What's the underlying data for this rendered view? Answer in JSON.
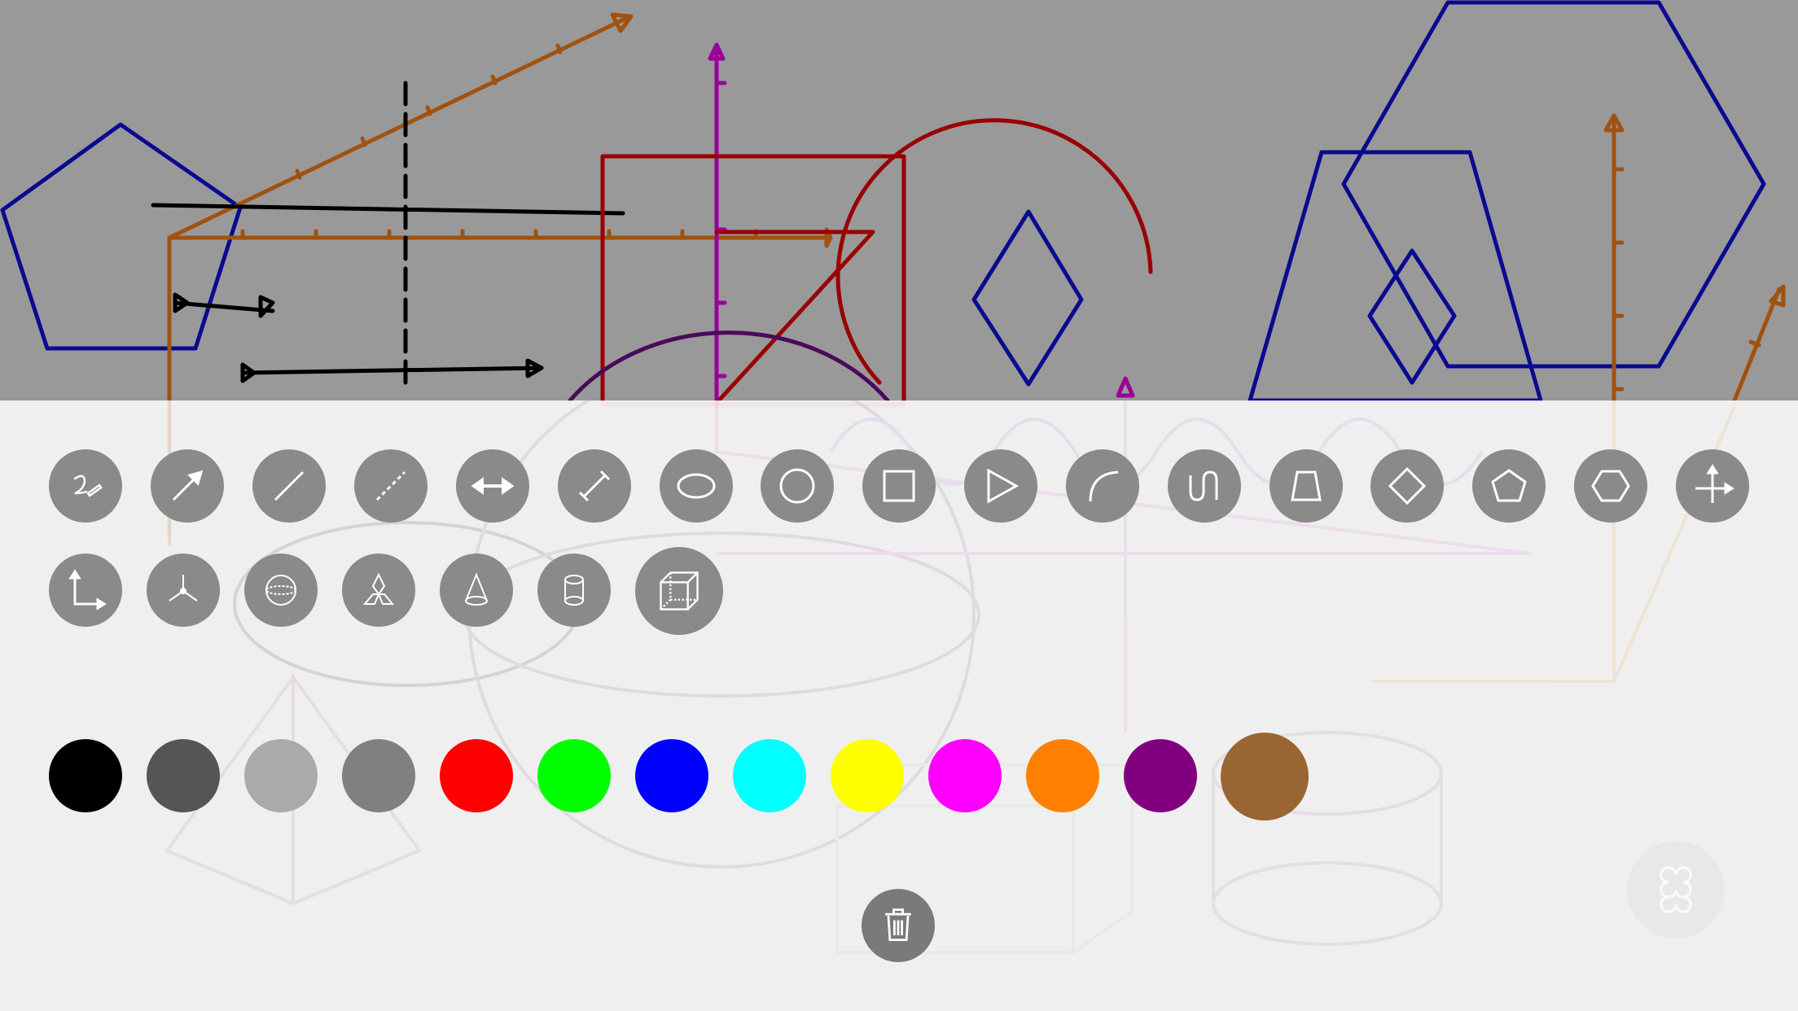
{
  "app": {
    "title": ""
  },
  "toolbar": {
    "shape_tools": [
      {
        "name": "freehand-tool",
        "icon": "freehand-icon"
      },
      {
        "name": "arrow-tool",
        "icon": "arrow-icon"
      },
      {
        "name": "line-tool",
        "icon": "line-icon"
      },
      {
        "name": "dashed-line-tool",
        "icon": "dashed-line-icon"
      },
      {
        "name": "double-arrow-tool",
        "icon": "double-arrow-icon"
      },
      {
        "name": "segment-tool",
        "icon": "segment-icon"
      },
      {
        "name": "ellipse-tool",
        "icon": "ellipse-icon"
      },
      {
        "name": "circle-tool",
        "icon": "circle-icon"
      },
      {
        "name": "square-tool",
        "icon": "square-icon"
      },
      {
        "name": "triangle-tool",
        "icon": "triangle-icon"
      },
      {
        "name": "arc-tool",
        "icon": "arc-icon"
      },
      {
        "name": "wave-tool",
        "icon": "wave-icon"
      },
      {
        "name": "trapezoid-tool",
        "icon": "trapezoid-icon"
      },
      {
        "name": "rhombus-tool",
        "icon": "rhombus-icon"
      },
      {
        "name": "pentagon-tool",
        "icon": "pentagon-icon"
      },
      {
        "name": "hexagon-tool",
        "icon": "hexagon-icon"
      },
      {
        "name": "axes-2d-tool",
        "icon": "cross-axes-icon"
      }
    ],
    "solid_tools": [
      {
        "name": "coordinate-axes-tool",
        "icon": "coordinate-axes-icon"
      },
      {
        "name": "axes-3d-tool",
        "icon": "axes-3d-icon"
      },
      {
        "name": "sphere-tool",
        "icon": "sphere-icon"
      },
      {
        "name": "prism-tool",
        "icon": "prism-icon"
      },
      {
        "name": "cone-tool",
        "icon": "cone-icon"
      },
      {
        "name": "cylinder-tool",
        "icon": "cylinder-icon"
      },
      {
        "name": "cube-tool",
        "icon": "cube-icon",
        "selected": true
      }
    ]
  },
  "palette": {
    "colors": [
      "#000000",
      "#555555",
      "#aaaaaa",
      "#808080",
      "#ff0000",
      "#00ff00",
      "#0000ff",
      "#00ffff",
      "#ffff00",
      "#ff00ff",
      "#ff8000",
      "#800080",
      "#996633"
    ],
    "selected_index": 12
  },
  "actions": {
    "trash_icon": "trash-icon",
    "menu_icon": "clover-menu-icon"
  }
}
